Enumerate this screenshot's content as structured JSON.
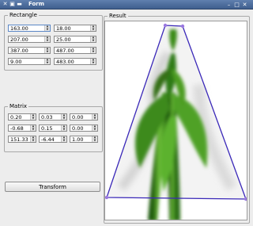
{
  "window": {
    "title": "Form",
    "icon": "app-icon"
  },
  "rectangle": {
    "legend": "Rectangle",
    "rows": [
      [
        "163.00",
        "18.00"
      ],
      [
        "207.00",
        "25.00"
      ],
      [
        "387.00",
        "487.00"
      ],
      [
        "9.00",
        "483.00"
      ]
    ]
  },
  "matrix": {
    "legend": "Matrix",
    "rows": [
      [
        "0.20",
        "0.03",
        "0.00"
      ],
      [
        "-0.68",
        "0.15",
        "0.00"
      ],
      [
        "151.33",
        "-6.44",
        "1.00"
      ]
    ]
  },
  "buttons": {
    "transform": "Transform"
  },
  "result": {
    "legend": "Result"
  },
  "colors": {
    "titlebar": "#4a6a9a",
    "quad": "#3a28b8",
    "handles": "#7a4ad0",
    "plant": "#3f8d1e"
  }
}
